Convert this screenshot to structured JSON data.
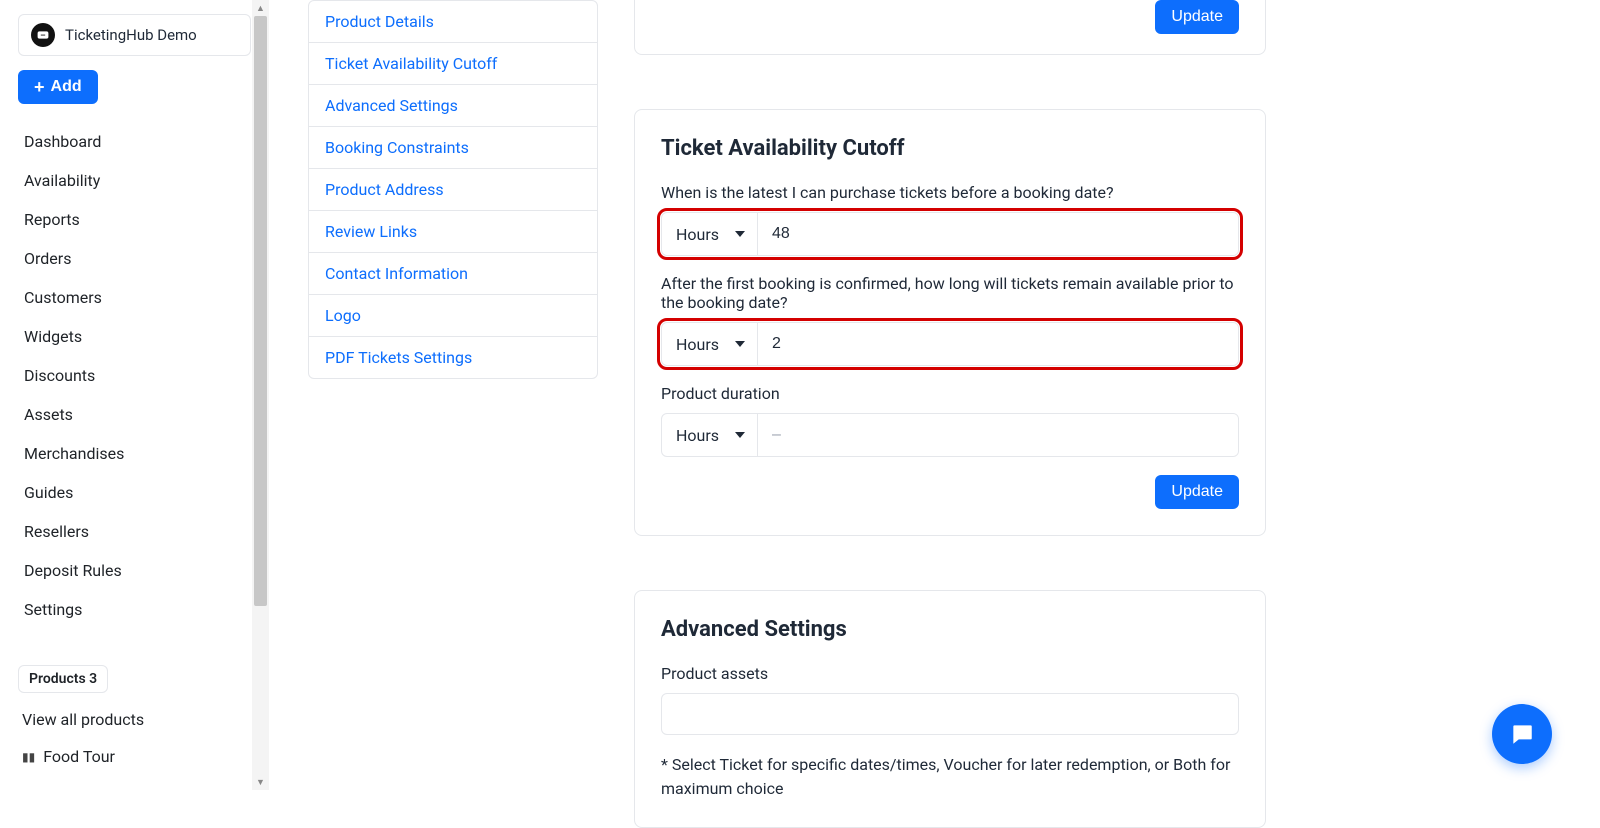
{
  "account": {
    "name": "TicketingHub Demo"
  },
  "sidebar": {
    "add_label": "Add",
    "items": [
      "Dashboard",
      "Availability",
      "Reports",
      "Orders",
      "Customers",
      "Widgets",
      "Discounts",
      "Assets",
      "Merchandises",
      "Guides",
      "Resellers",
      "Deposit Rules",
      "Settings"
    ],
    "products_label": "Products 3",
    "view_all_label": "View all products",
    "product_items": [
      "Food Tour"
    ]
  },
  "submenu": [
    "Product Details",
    "Ticket Availability Cutoff",
    "Advanced Settings",
    "Booking Constraints",
    "Product Address",
    "Review Links",
    "Contact Information",
    "Logo",
    "PDF Tickets Settings"
  ],
  "top_update_label": "Update",
  "cutoff": {
    "title": "Ticket Availability Cutoff",
    "q1": "When is the latest I can purchase tickets before a booking date?",
    "unit1": "Hours",
    "value1": "48",
    "q2": "After the first booking is confirmed, how long will tickets remain available prior to the booking date?",
    "unit2": "Hours",
    "value2": "2",
    "q3": "Product duration",
    "unit3": "Hours",
    "value3": "",
    "value3_placeholder": "–",
    "update_label": "Update"
  },
  "advanced": {
    "title": "Advanced Settings",
    "assets_label": "Product assets",
    "assets_value": "",
    "hint": "* Select Ticket for specific dates/times, Voucher for later redemption, or Both for maximum choice"
  }
}
